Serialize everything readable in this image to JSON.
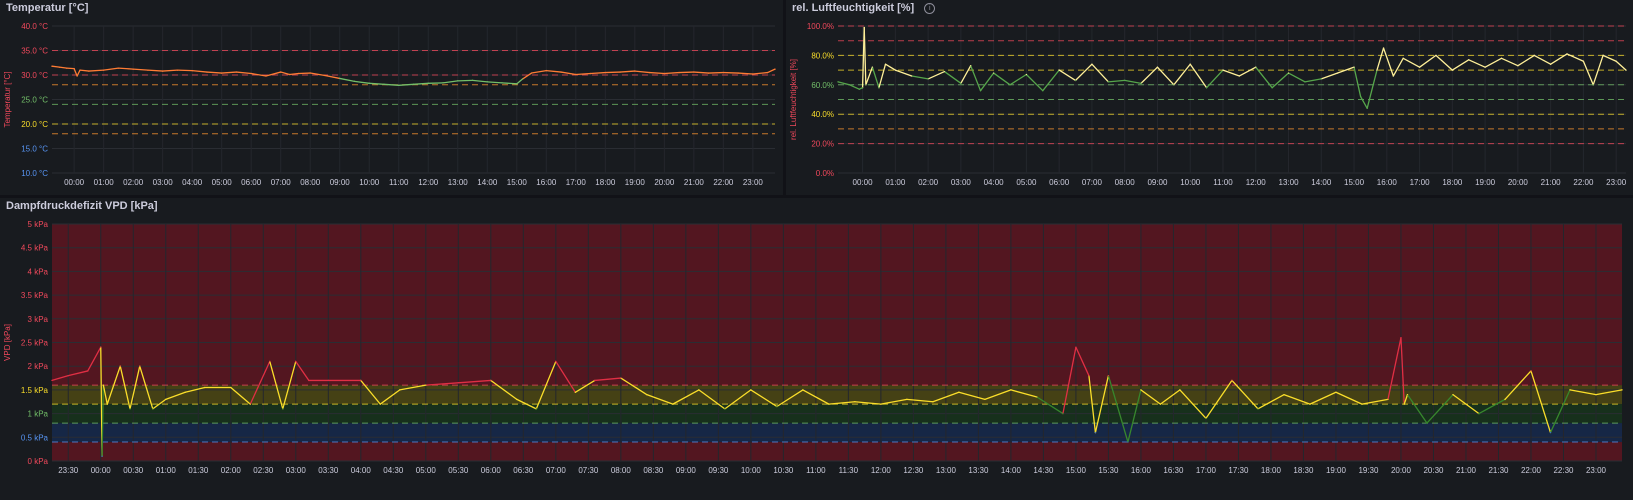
{
  "panels": {
    "temp": {
      "title": "Temperatur [°C]",
      "chart_data": {
        "type": "line",
        "ylabel": "Temperatur [°C]",
        "ylim": [
          10,
          40
        ],
        "yticks": [
          {
            "v": 40,
            "label": "40.0 °C",
            "color": "#f2495c"
          },
          {
            "v": 35,
            "label": "35.0 °C",
            "color": "#f2495c"
          },
          {
            "v": 30,
            "label": "30.0 °C",
            "color": "#f2495c"
          },
          {
            "v": 25,
            "label": "25.0 °C",
            "color": "#73bf69"
          },
          {
            "v": 20,
            "label": "20.0 °C",
            "color": "#fade2a"
          },
          {
            "v": 15,
            "label": "15.0 °C",
            "color": "#5794f2"
          },
          {
            "v": 10,
            "label": "10.0 °C",
            "color": "#5794f2"
          }
        ],
        "x_labels": [
          "00:00",
          "01:00",
          "02:00",
          "03:00",
          "04:00",
          "05:00",
          "06:00",
          "07:00",
          "08:00",
          "09:00",
          "10:00",
          "11:00",
          "12:00",
          "13:00",
          "14:00",
          "15:00",
          "16:00",
          "17:00",
          "18:00",
          "19:00",
          "20:00",
          "21:00",
          "22:00",
          "23:00"
        ],
        "x_range_hours": [
          -0.75,
          23.75
        ],
        "thresholds": [
          {
            "v": 35,
            "color": "#f2495c"
          },
          {
            "v": 30,
            "color": "#f2495c"
          },
          {
            "v": 28,
            "color": "#ff9830"
          },
          {
            "v": 24,
            "color": "#73bf69"
          },
          {
            "v": 20,
            "color": "#fade2a"
          },
          {
            "v": 18,
            "color": "#ff9830"
          }
        ],
        "series": [
          {
            "color_rule": "orange above 29.5, green below",
            "x_hours": [
              -0.75,
              -0.5,
              -0.25,
              0,
              0.1,
              0.2,
              0.5,
              1,
              1.5,
              2,
              2.5,
              3,
              3.5,
              4,
              4.5,
              5,
              5.5,
              6,
              6.5,
              7,
              7.3,
              7.6,
              8,
              8.5,
              9,
              9.5,
              10,
              10.5,
              11,
              11.5,
              12,
              12.5,
              13,
              13.5,
              14,
              14.5,
              15,
              15.2,
              15.5,
              16,
              16.5,
              17,
              17.5,
              18,
              18.5,
              19,
              19.5,
              20,
              20.5,
              21,
              21.5,
              22,
              22.5,
              23,
              23.5,
              23.75
            ],
            "y": [
              31.8,
              31.6,
              31.4,
              31.3,
              29.8,
              31.0,
              30.8,
              31.0,
              31.4,
              31.2,
              31.0,
              30.8,
              31.0,
              30.9,
              30.6,
              30.4,
              30.6,
              30.3,
              29.8,
              30.6,
              30.1,
              30.3,
              30.4,
              29.9,
              29.3,
              28.7,
              28.3,
              28.1,
              27.9,
              28.1,
              28.3,
              28.4,
              28.8,
              28.9,
              28.6,
              28.4,
              28.2,
              29.2,
              30.4,
              30.9,
              30.6,
              30.1,
              30.3,
              30.5,
              30.6,
              30.8,
              30.5,
              30.3,
              30.5,
              30.6,
              30.4,
              30.5,
              30.4,
              30.2,
              30.5,
              31.2
            ]
          }
        ]
      }
    },
    "hum": {
      "title": "rel. Luftfeuchtigkeit [%]",
      "chart_data": {
        "type": "line",
        "ylabel": "rel. Luftfeuchtigkeit [%]",
        "ylim": [
          0,
          100
        ],
        "yticks": [
          {
            "v": 100,
            "label": "100.0%",
            "color": "#f2495c"
          },
          {
            "v": 80,
            "label": "80.0%",
            "color": "#fade2a"
          },
          {
            "v": 60,
            "label": "60.0%",
            "color": "#73bf69"
          },
          {
            "v": 40,
            "label": "40.0%",
            "color": "#fade2a"
          },
          {
            "v": 20,
            "label": "20.0%",
            "color": "#f2495c"
          },
          {
            "v": 0,
            "label": "0.0%",
            "color": "#f2495c"
          }
        ],
        "x_labels": [
          "00:00",
          "01:00",
          "02:00",
          "03:00",
          "04:00",
          "05:00",
          "06:00",
          "07:00",
          "08:00",
          "09:00",
          "10:00",
          "11:00",
          "12:00",
          "13:00",
          "14:00",
          "15:00",
          "16:00",
          "17:00",
          "18:00",
          "19:00",
          "20:00",
          "21:00",
          "22:00",
          "23:00"
        ],
        "x_range_hours": [
          -0.75,
          23.3
        ],
        "thresholds": [
          {
            "v": 100,
            "color": "#f2495c"
          },
          {
            "v": 90,
            "color": "#f2495c"
          },
          {
            "v": 80,
            "color": "#fade2a"
          },
          {
            "v": 70,
            "color": "#fade2a"
          },
          {
            "v": 60,
            "color": "#73bf69"
          },
          {
            "v": 50,
            "color": "#73bf69"
          },
          {
            "v": 40,
            "color": "#fade2a"
          },
          {
            "v": 30,
            "color": "#ff9830"
          },
          {
            "v": 20,
            "color": "#f2495c"
          }
        ],
        "series": [
          {
            "color_rule": "yellow above 65, green below",
            "x_hours": [
              -0.75,
              -0.4,
              -0.1,
              0,
              0.05,
              0.1,
              0.3,
              0.5,
              0.7,
              1,
              1.5,
              2,
              2.5,
              3,
              3.3,
              3.6,
              4,
              4.5,
              5,
              5.5,
              6,
              6.5,
              7,
              7.5,
              8,
              8.5,
              9,
              9.5,
              10,
              10.5,
              11,
              11.5,
              12,
              12.5,
              13,
              13.5,
              14,
              14.5,
              15,
              15.2,
              15.4,
              15.7,
              15.9,
              16.2,
              16.5,
              17,
              17.5,
              18,
              18.5,
              19,
              19.5,
              20,
              20.5,
              21,
              21.5,
              22,
              22.3,
              22.6,
              23,
              23.3
            ],
            "y": [
              62,
              60,
              57,
              58,
              99,
              60,
              72,
              58,
              74,
              70,
              66,
              64,
              69,
              61,
              73,
              56,
              68,
              60,
              67,
              56,
              70,
              63,
              74,
              62,
              63,
              61,
              72,
              60,
              74,
              58,
              70,
              66,
              72,
              58,
              68,
              62,
              64,
              68,
              72,
              52,
              44,
              70,
              85,
              66,
              78,
              72,
              80,
              70,
              77,
              72,
              78,
              73,
              80,
              74,
              81,
              76,
              60,
              80,
              76,
              70
            ]
          }
        ]
      }
    },
    "vpd": {
      "title": "Dampfdruckdefizit VPD [kPa]",
      "chart_data": {
        "type": "line",
        "ylabel": "VPD [kPa]",
        "ylim": [
          0,
          5
        ],
        "yticks": [
          {
            "v": 5,
            "label": "5 kPa"
          },
          {
            "v": 4.5,
            "label": "4.5 kPa"
          },
          {
            "v": 4,
            "label": "4 kPa"
          },
          {
            "v": 3.5,
            "label": "3.5 kPa"
          },
          {
            "v": 3,
            "label": "3 kPa"
          },
          {
            "v": 2.5,
            "label": "2.5 kPa"
          },
          {
            "v": 2,
            "label": "2 kPa"
          },
          {
            "v": 1.5,
            "label": "1.5 kPa"
          },
          {
            "v": 1,
            "label": "1 kPa"
          },
          {
            "v": 0.5,
            "label": "0.5 kPa"
          },
          {
            "v": 0,
            "label": "0 kPa"
          }
        ],
        "tick_colors": {
          "red": "#f2495c",
          "yellow": "#fade2a",
          "green": "#73bf69",
          "blue": "#5794f2"
        },
        "x_labels": [
          "23:30",
          "00:00",
          "00:30",
          "01:00",
          "01:30",
          "02:00",
          "02:30",
          "03:00",
          "03:30",
          "04:00",
          "04:30",
          "05:00",
          "05:30",
          "06:00",
          "06:30",
          "07:00",
          "07:30",
          "08:00",
          "08:30",
          "09:00",
          "09:30",
          "10:00",
          "10:30",
          "11:00",
          "11:30",
          "12:00",
          "12:30",
          "13:00",
          "13:30",
          "14:00",
          "14:30",
          "15:00",
          "15:30",
          "16:00",
          "16:30",
          "17:00",
          "17:30",
          "18:00",
          "18:30",
          "19:00",
          "19:30",
          "20:00",
          "20:30",
          "21:00",
          "21:30",
          "22:00",
          "22:30",
          "23:00"
        ],
        "x_range_hours": [
          -0.75,
          23.4
        ],
        "bands": [
          {
            "from": 1.6,
            "to": 5,
            "color": "#5a1620"
          },
          {
            "from": 1.2,
            "to": 1.6,
            "color": "#4a4614"
          },
          {
            "from": 0.8,
            "to": 1.2,
            "color": "#17331c"
          },
          {
            "from": 0.4,
            "to": 0.8,
            "color": "#16294a"
          },
          {
            "from": 0,
            "to": 0.4,
            "color": "#5a1620"
          }
        ],
        "thresholds": [
          {
            "v": 1.6,
            "color": "#f2495c"
          },
          {
            "v": 1.2,
            "color": "#fade2a"
          },
          {
            "v": 0.8,
            "color": "#73bf69"
          },
          {
            "v": 0.4,
            "color": "#5794f2"
          }
        ],
        "series": [
          {
            "color_rule": "red >1.6, yellow 1.2-1.6, green 0.8-1.2, blue <0.8",
            "x_hours": [
              -0.75,
              -0.5,
              -0.2,
              0,
              0.02,
              0.04,
              0.1,
              0.3,
              0.45,
              0.6,
              0.8,
              1,
              1.3,
              1.6,
              2,
              2.3,
              2.6,
              2.8,
              3,
              3.2,
              3.5,
              4,
              4.3,
              4.6,
              5,
              5.5,
              6,
              6.4,
              6.7,
              7,
              7.3,
              7.6,
              8,
              8.4,
              8.8,
              9.2,
              9.6,
              10,
              10.4,
              10.8,
              11.2,
              11.6,
              12,
              12.4,
              12.8,
              13.2,
              13.6,
              14,
              14.4,
              14.8,
              15,
              15.2,
              15.3,
              15.5,
              15.8,
              16,
              16.3,
              16.6,
              17,
              17.4,
              17.8,
              18.2,
              18.6,
              19,
              19.4,
              19.8,
              20,
              20.05,
              20.1,
              20.4,
              20.8,
              21.2,
              21.6,
              22,
              22.3,
              22.6,
              23,
              23.4
            ],
            "y": [
              1.7,
              1.8,
              1.9,
              2.4,
              0.1,
              1.6,
              1.2,
              2.0,
              1.1,
              2.0,
              1.1,
              1.3,
              1.45,
              1.55,
              1.55,
              1.2,
              2.1,
              1.1,
              2.1,
              1.7,
              1.7,
              1.7,
              1.2,
              1.5,
              1.6,
              1.65,
              1.7,
              1.3,
              1.1,
              2.1,
              1.45,
              1.7,
              1.75,
              1.4,
              1.2,
              1.5,
              1.1,
              1.5,
              1.15,
              1.5,
              1.2,
              1.25,
              1.2,
              1.3,
              1.25,
              1.45,
              1.3,
              1.5,
              1.35,
              1.0,
              2.4,
              1.8,
              0.6,
              1.8,
              0.4,
              1.5,
              1.2,
              1.5,
              0.9,
              1.7,
              1.1,
              1.4,
              1.2,
              1.45,
              1.2,
              1.3,
              2.6,
              1.2,
              1.4,
              0.8,
              1.4,
              1.0,
              1.3,
              1.9,
              0.6,
              1.5,
              1.4,
              1.5
            ]
          }
        ]
      }
    }
  }
}
